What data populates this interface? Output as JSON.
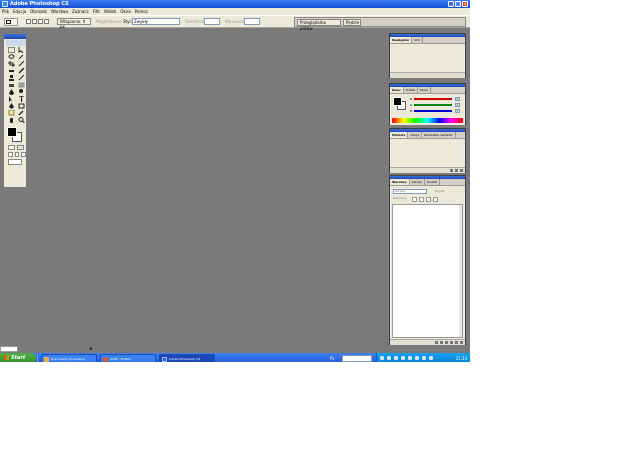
{
  "window": {
    "title": "Adobe Photoshop CS",
    "min": "_",
    "max": "□",
    "close": "x"
  },
  "menu": [
    "Plik",
    "Edycja",
    "Obrazek",
    "Warstwa",
    "Zaznacz",
    "Filtr",
    "Widok",
    "Okno",
    "Pomoc"
  ],
  "options": {
    "feather_label": "Wtapianie: 0 px",
    "antialias_label": "Wygładzanie",
    "style_label": "Styl:",
    "style_value": "Zwykły",
    "width_label": "Szerokość:",
    "height_label": "Wysokość:",
    "well_tabs": [
      "Przeglądarka plików",
      "Pędzle"
    ]
  },
  "palettes": {
    "navigator": {
      "tabs": [
        "Nawigator",
        "Info"
      ]
    },
    "color": {
      "tabs": [
        "Kolor",
        "Próbki",
        "Style"
      ],
      "channels": [
        {
          "label": "R",
          "value": "0",
          "color": "#cc0000"
        },
        {
          "label": "G",
          "value": "0",
          "color": "#008800"
        },
        {
          "label": "B",
          "value": "0",
          "color": "#0000cc"
        }
      ]
    },
    "history": {
      "tabs": [
        "Historia",
        "Opcje",
        "Narzędzia narzędzi"
      ]
    },
    "layers": {
      "tabs": [
        "Warstwy",
        "Kanały",
        "Ścieżki"
      ],
      "mode": "Zwykły",
      "opacity": "Krycie:",
      "lock": "Zablokuj:"
    }
  },
  "taskbar": {
    "start": "Start",
    "tasks": [
      {
        "label": "Dokumenty Photoshop",
        "icon": "folder-icon"
      },
      {
        "label": "GIMP - Firefox",
        "icon": "firefox-icon"
      },
      {
        "label": "Adobe Photoshop CS",
        "icon": "photoshop-icon"
      }
    ],
    "lang": "PL",
    "clock": "21:33"
  },
  "colors": {
    "canvas": "#7a7a7a",
    "chrome": "#ece9d8",
    "taskbar": "#2459d8"
  }
}
